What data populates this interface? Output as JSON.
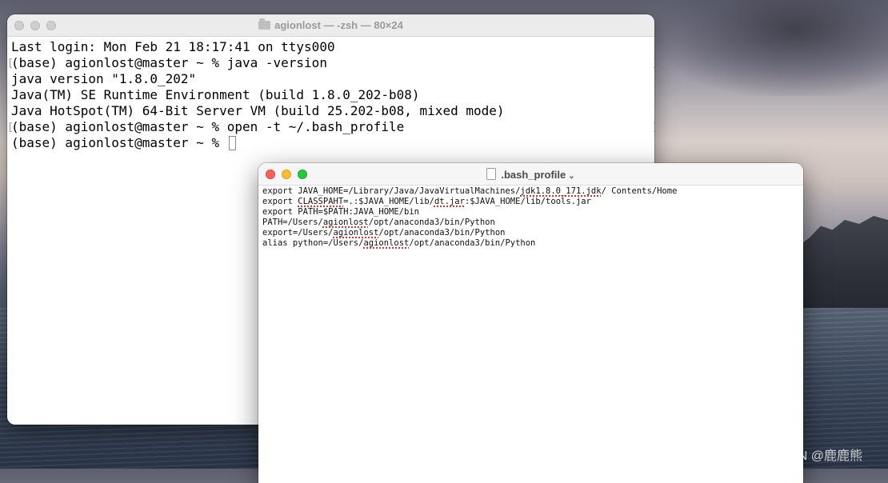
{
  "desktop": {
    "watermark": "CSDN @鹿鹿熊"
  },
  "terminal": {
    "title": "agionlost — -zsh — 80×24",
    "lines": [
      "Last login: Mon Feb 21 18:17:41 on ttys000",
      "(base) agionlost@master ~ % java -version",
      "java version \"1.8.0_202\"",
      "Java(TM) SE Runtime Environment (build 1.8.0_202-b08)",
      "Java HotSpot(TM) 64-Bit Server VM (build 25.202-b08, mixed mode)",
      "(base) agionlost@master ~ % open -t ~/.bash_profile",
      "(base) agionlost@master ~ % "
    ]
  },
  "editor": {
    "title": ".bash_profile",
    "chevron": "⌄",
    "lines": [
      {
        "a": "export JAVA_HOME=/Library/Java/JavaVirtualMachines/",
        "s": "jdk1.8.0_171.jdk",
        "b": "/ Contents/Home"
      },
      {
        "a": "export ",
        "s": "CLASSPAHT",
        "b": "=.:$JAVA_HOME/lib/",
        "s2": "dt.jar",
        "c": ":$JAVA_HOME/lib/tools.jar"
      },
      {
        "a": "export PATH=$PATH:JAVA_HOME/bin",
        "s": "",
        "b": ""
      },
      {
        "a": "PATH=/Users/",
        "s": "agionlost",
        "b": "/opt/anaconda3/bin/Python"
      },
      {
        "a": "export=/Users/",
        "s": "agionlost",
        "b": "/opt/anaconda3/bin/Python"
      },
      {
        "a": "alias python=/Users/",
        "s": "agionlost",
        "b": "/opt/anaconda3/bin/Python"
      }
    ]
  },
  "colors": {
    "close": "#fe5f57",
    "minimize": "#febc2e",
    "zoom": "#28c840"
  }
}
